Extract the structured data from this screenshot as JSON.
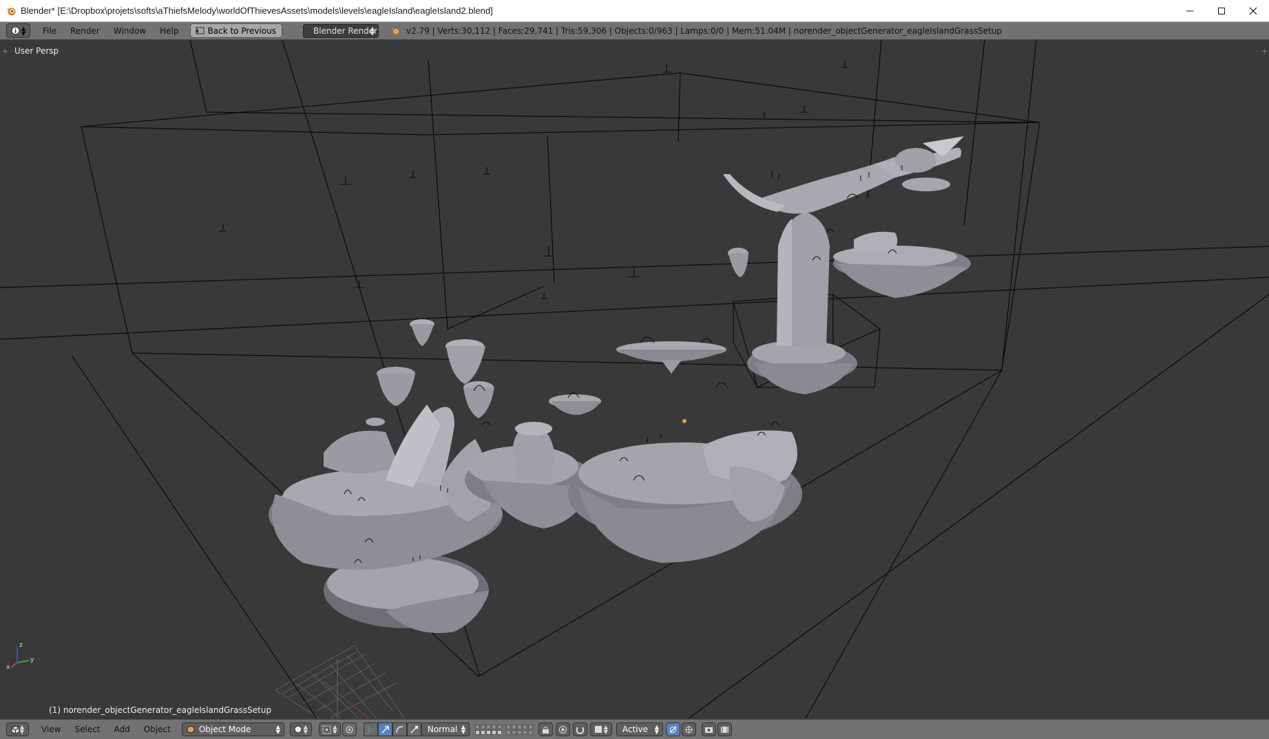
{
  "window": {
    "title": "Blender* [E:\\Dropbox\\projets\\softs\\aThiefsMelody\\worldOfThievesAssets\\models\\levels\\eagleIsland\\eagleIsland2.blend]",
    "controls": {
      "minimize_icon": "minimize-icon",
      "maximize_icon": "maximize-icon",
      "close_icon": "close-icon"
    }
  },
  "info_header": {
    "menu": [
      "File",
      "Render",
      "Window",
      "Help"
    ],
    "back_button": "Back to Previous",
    "render_engine": "Blender Render",
    "stats": "v2.79 | Verts:30,112 | Faces:29,741 | Tris:59,306 | Objects:0/963 | Lamps:0/0 | Mem:51.04M | norender_objectGenerator_eagleIslandGrassSetup"
  },
  "viewport": {
    "view_label": "User Persp",
    "object_label": "(1) norender_objectGenerator_eagleIslandGrassSetup",
    "axis": {
      "x": "x",
      "y": "y",
      "z": "z"
    }
  },
  "bottom_header": {
    "menu": [
      "View",
      "Select",
      "Add",
      "Object"
    ],
    "mode": "Object Mode",
    "orientation": "Normal",
    "snap_target": "Active"
  },
  "colors": {
    "viewport_bg": "#393939",
    "header_bg": "#727272",
    "mesh": "#a4a4ac",
    "mesh_shadow": "#6e6e76",
    "wire": "#0a0a0a",
    "grid": "#6a6a6a",
    "origin": "#e8a030"
  }
}
